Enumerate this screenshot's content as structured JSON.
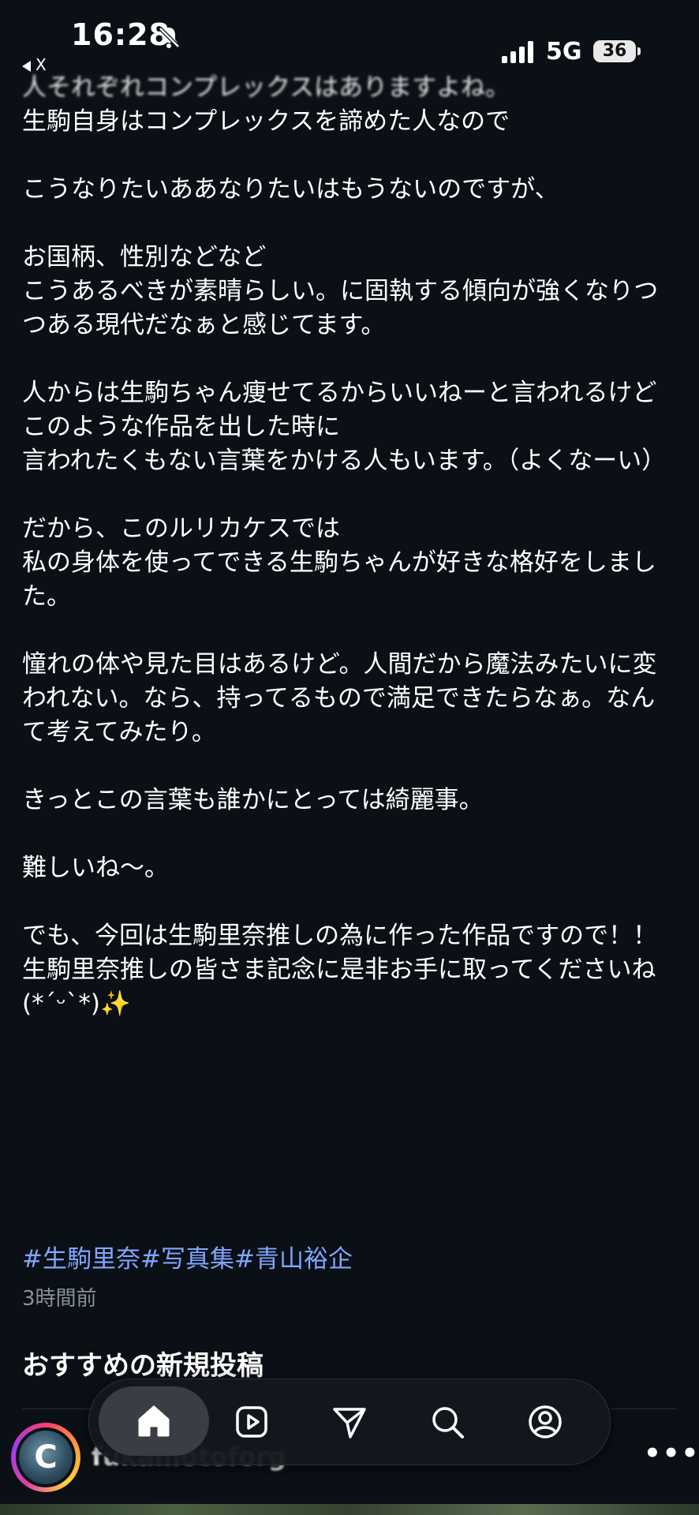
{
  "status_bar": {
    "time": "16:28",
    "back_label": "X",
    "network": "5G",
    "battery": "36"
  },
  "post": {
    "faded_line": "人それぞれコンプレックスはありますよね。",
    "body": "生駒自身はコンプレックスを諦めた人なので\n\nこうなりたいああなりたいはもうないのですが、\n\nお国柄、性別などなど\nこうあるべきが素晴らしい。に固執する傾向が強くなりつつある現代だなぁと感じてます。\n\n人からは生駒ちゃん痩せてるからいいねーと言われるけど\nこのような作品を出した時に\n言われたくもない言葉をかける人もいます。（よくなーい）\n\nだから、このルリカケスでは\n私の身体を使ってできる生駒ちゃんが好きな格好をしました。\n\n憧れの体や見た目はあるけど。人間だから魔法みたいに変われない。なら、持ってるもので満足できたらなぁ。なんて考えてみたり。\n\nきっとこの言葉も誰かにとっては綺麗事。\n\n難しいね〜。\n\nでも、今回は生駒里奈推しの為に作った作品ですので！！\n生駒里奈推しの皆さま記念に是非お手に取ってくださいね (*´ᵕ`*)✨",
    "hashtags": [
      "#生駒里奈",
      "#写真集",
      "#青山裕企"
    ],
    "timestamp": "3時間前"
  },
  "section": {
    "title": "おすすめの新規投稿"
  },
  "next_post": {
    "avatar_letter": "C",
    "username": "fukamotoforg",
    "more": "•••"
  },
  "nav": {
    "items": [
      "home-icon",
      "reels-icon",
      "send-icon",
      "search-icon",
      "profile-icon"
    ]
  }
}
